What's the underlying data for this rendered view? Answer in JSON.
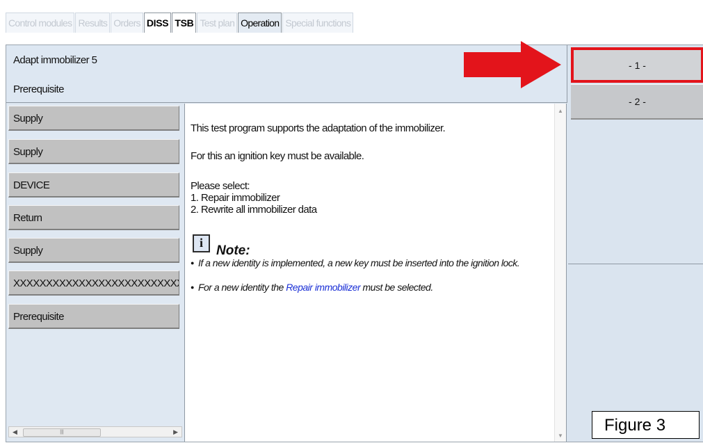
{
  "tabs": [
    {
      "label": "Control modules",
      "state": "disabled"
    },
    {
      "label": "Results",
      "state": "disabled"
    },
    {
      "label": "Orders",
      "state": "disabled"
    },
    {
      "label": "DISS",
      "state": "active-bold"
    },
    {
      "label": "TSB",
      "state": "active-bold"
    },
    {
      "label": "Test plan",
      "state": "disabled"
    },
    {
      "label": "Operation",
      "state": "current"
    },
    {
      "label": "Special functions",
      "state": "disabled"
    }
  ],
  "header": {
    "title": "Adapt immobilizer 5",
    "subtitle": "Prerequisite"
  },
  "left_list": {
    "items": [
      "Supply",
      "Supply",
      "DEVICE",
      "Return",
      "Supply",
      "XXXXXXXXXXXXXXXXXXXXXXXXXXX",
      "Prerequisite"
    ]
  },
  "content": {
    "line1": "This test program supports the adaptation of the immobilizer.",
    "line2": "For this an ignition key must be available.",
    "select_title": "Please select:",
    "option1": "1. Repair immobilizer",
    "option2": "2. Rewrite all immobilizer data",
    "note_icon": "i",
    "note_label": "Note:",
    "bullet1": "If a new identity is implemented, a new key must be inserted into the ignition lock.",
    "bullet2_pre": "For a new identity the ",
    "bullet2_link": "Repair immobilizer",
    "bullet2_post": " must be selected."
  },
  "right_buttons": [
    "- 1 -",
    "- 2 -"
  ],
  "figure_label": "Figure 3",
  "colors": {
    "highlight_red": "#e3141b",
    "link_blue": "#1a2fd6",
    "panel_bg": "#dae4ef"
  }
}
